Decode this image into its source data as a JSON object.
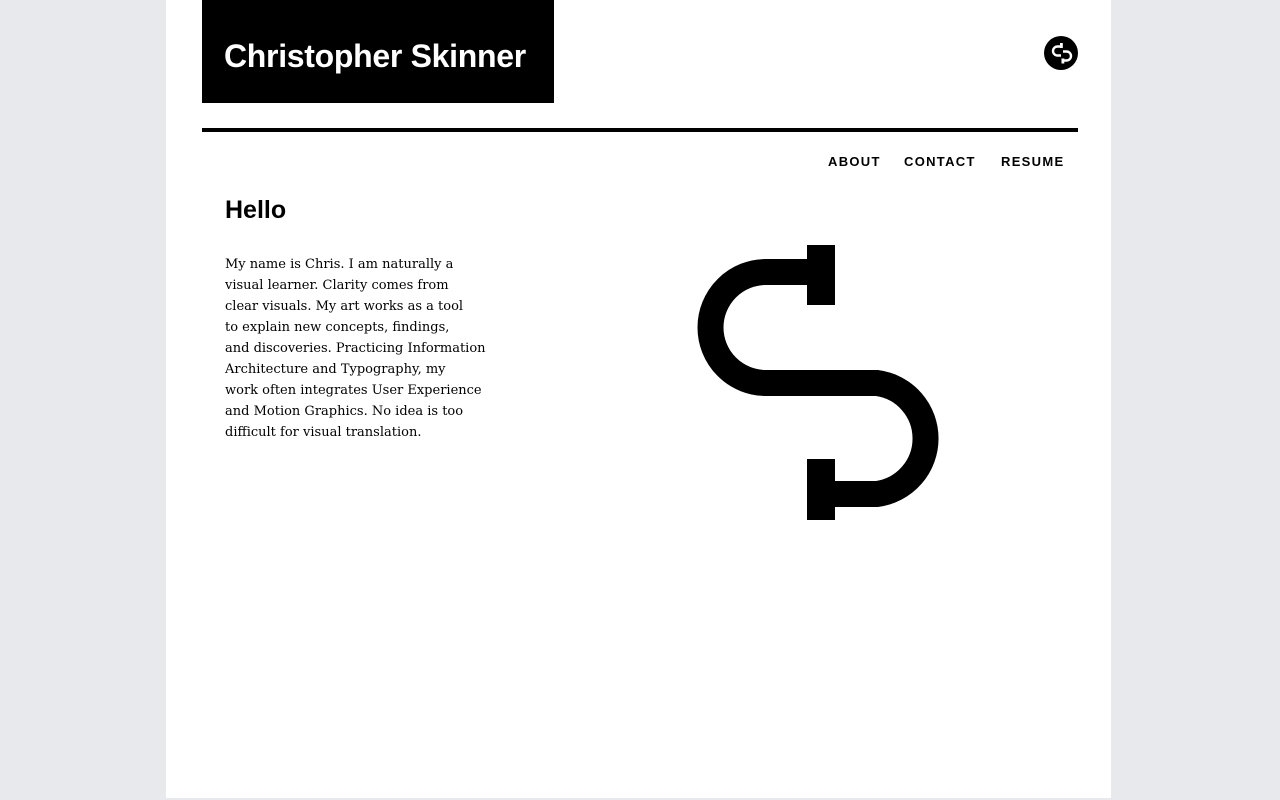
{
  "header": {
    "site_title": "Christopher Skinner",
    "logo_icon": "cs-monogram-icon"
  },
  "nav": {
    "items": [
      {
        "label": "ABOUT"
      },
      {
        "label": "CONTACT"
      },
      {
        "label": "RESUME"
      }
    ]
  },
  "main": {
    "heading": "Hello",
    "bio_lines": [
      "My name is Chris. I am naturally a",
      "visual learner. Clarity comes from",
      "clear visuals. My art works as a tool",
      "to explain new concepts, findings,",
      "and discoveries. Practicing  Information",
      "Architecture and Typography, my",
      "work often integrates User Experience",
      "and Motion Graphics. No idea is too",
      "difficult for visual translation."
    ],
    "hero_icon": "cs-monogram-icon"
  },
  "colors": {
    "background": "#e8e9ed",
    "page": "#ffffff",
    "ink": "#000000"
  }
}
